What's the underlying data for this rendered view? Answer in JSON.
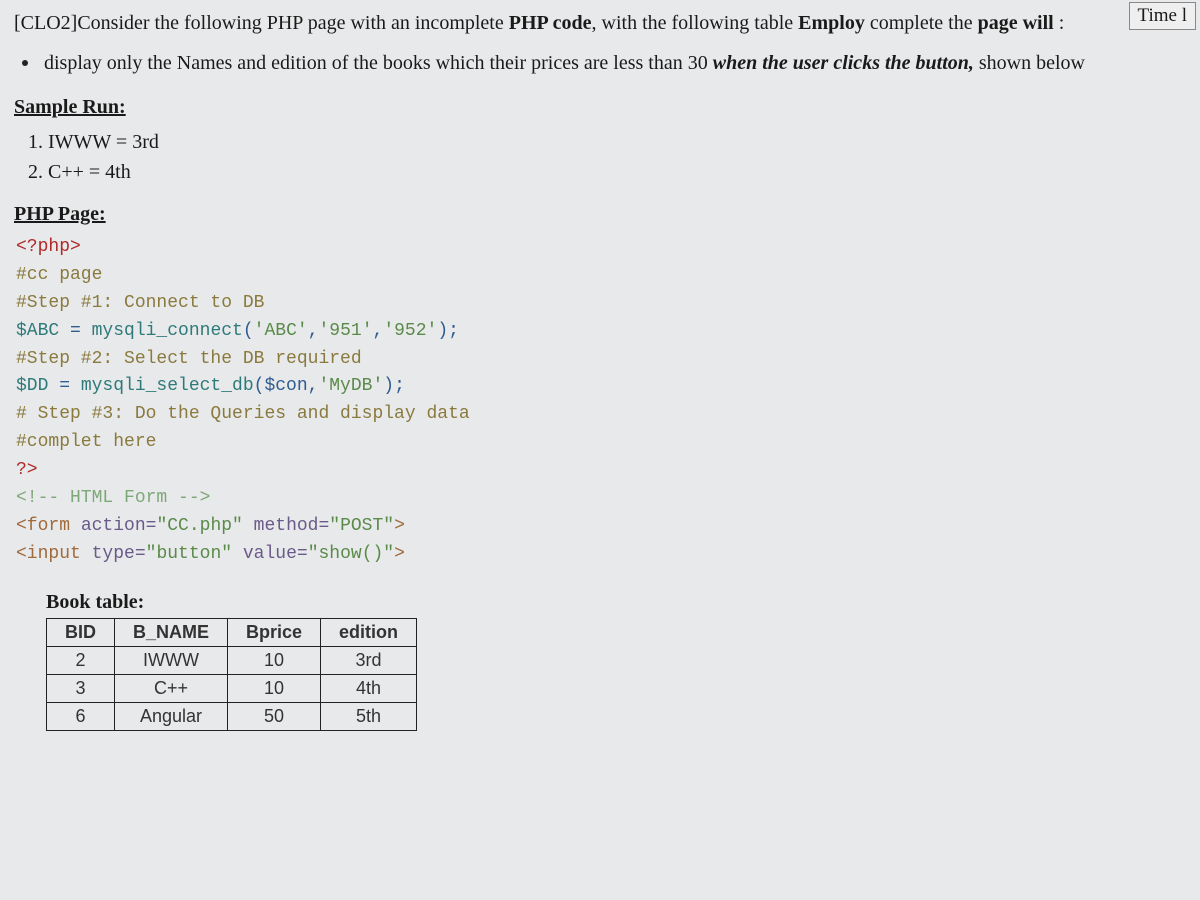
{
  "timebox": "Time l",
  "intro": {
    "prefix": "[CLO2]Consider the following PHP page with an incomplete ",
    "bold1": "PHP code",
    "mid": ", with the following table ",
    "bold2": "Employ",
    "after": " complete the ",
    "bold3": "page will",
    "tail": " :"
  },
  "bullet": {
    "part1": "display only the Names  and edition of the books which their prices are less than 30 ",
    "italic": "when the user clicks the button,",
    "part2": " shown below"
  },
  "sample_run_heading": "Sample Run:",
  "sample_run": {
    "line1": "1. IWWW = 3rd",
    "line2": "2. C++ = 4th"
  },
  "php_page_heading": "PHP Page:",
  "code": {
    "l1": "<?php>",
    "l2": "#cc page",
    "l3": "#Step #1: Connect to DB",
    "l4a": "$ABC",
    "l4b": " = ",
    "l4c": "mysqli_connect",
    "l4d": "(",
    "l4e": "'ABC'",
    "l4f": ",",
    "l4g": "'951'",
    "l4h": ",",
    "l4i": "'952'",
    "l4j": ");",
    "l5": "#Step #2: Select the DB required",
    "l6a": "$DD",
    "l6b": " = ",
    "l6c": "mysqli_select_db",
    "l6d": "($con,",
    "l6e": "'MyDB'",
    "l6f": ");",
    "l7": "# Step #3: Do the Queries and display data",
    "l8": "#complet here",
    "l9": "?>",
    "l10": "<!-- HTML Form -->",
    "l11a": "<form ",
    "l11b": "action=",
    "l11c": "\"CC.php\"",
    "l11d": " method=",
    "l11e": "\"POST\"",
    "l11f": ">",
    "l12a": "<input ",
    "l12b": "type=",
    "l12c": "\"button\"",
    "l12d": " value=",
    "l12e": "\"show()\"",
    "l12f": ">"
  },
  "table_caption": "Book table:",
  "table_headers": [
    "BID",
    "B_NAME",
    "Bprice",
    "edition"
  ],
  "table_rows": [
    [
      "2",
      "IWWW",
      "10",
      "3rd"
    ],
    [
      "3",
      "C++",
      "10",
      "4th"
    ],
    [
      "6",
      "Angular",
      "50",
      "5th"
    ]
  ]
}
